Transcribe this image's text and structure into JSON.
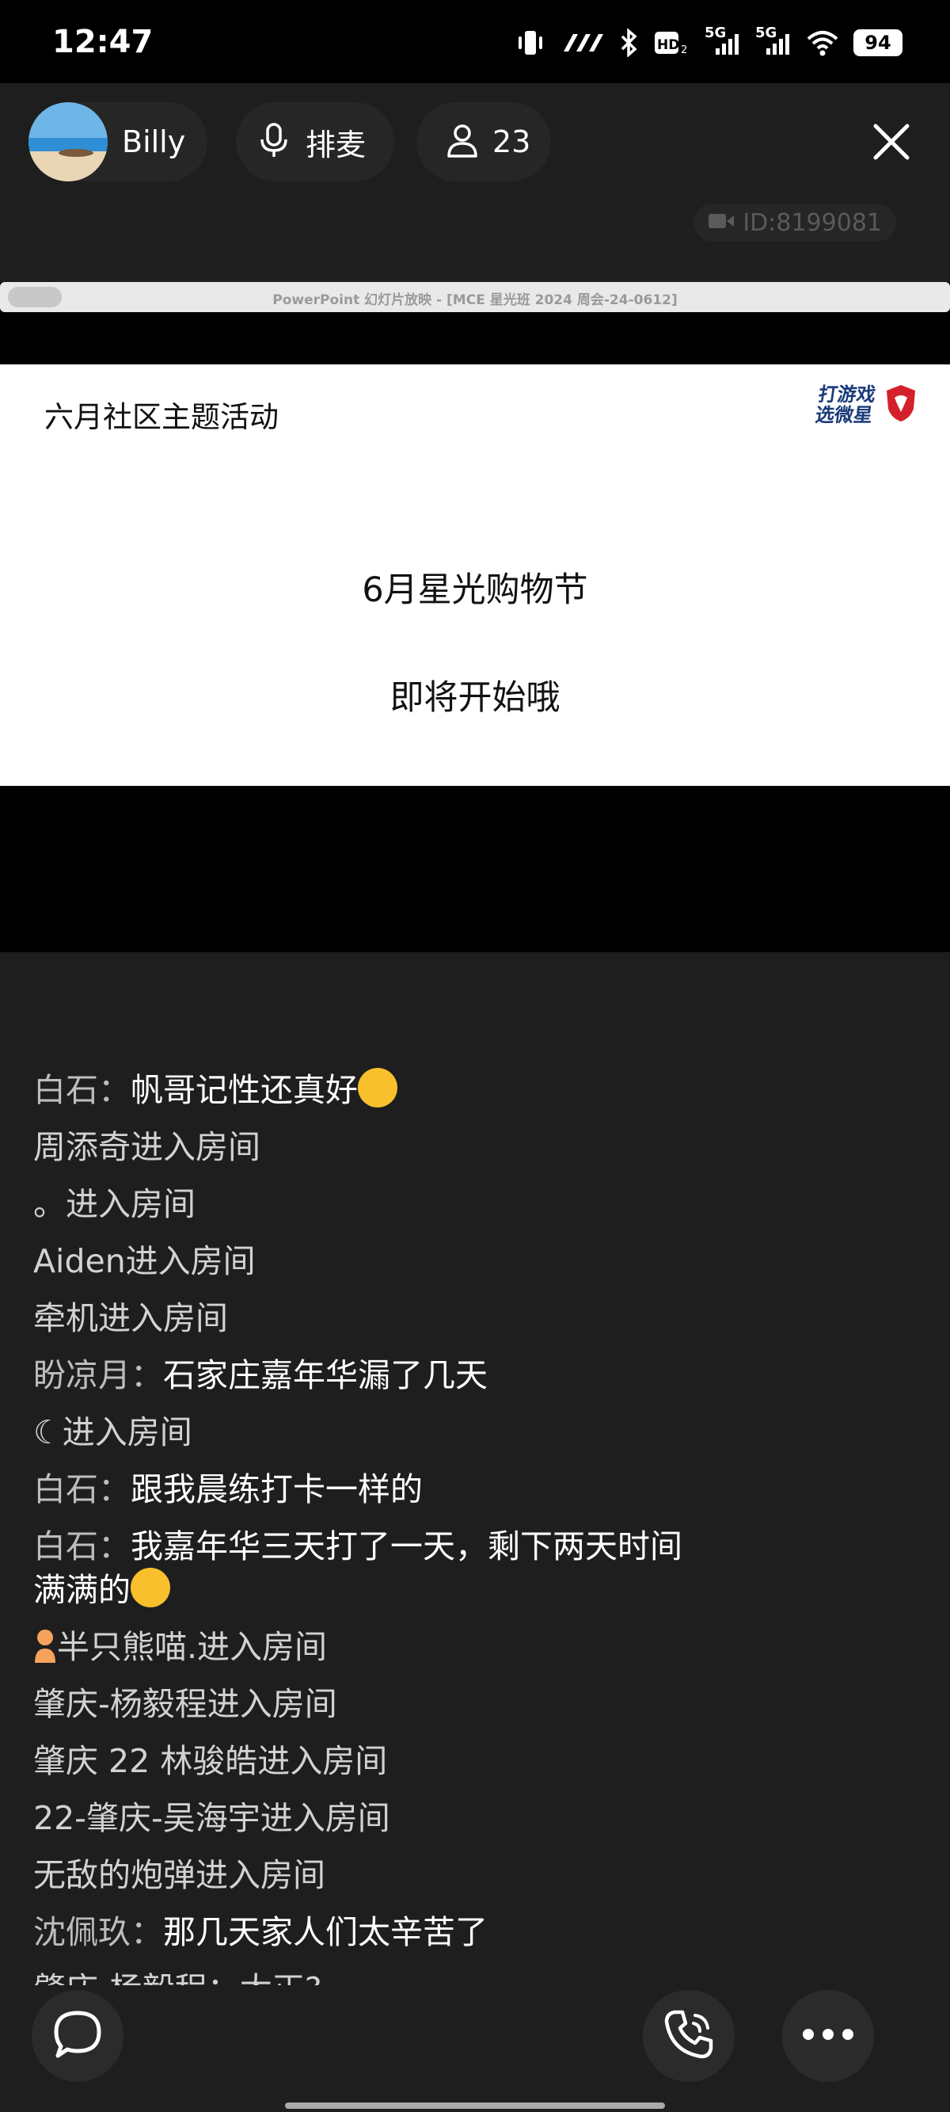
{
  "status_bar": {
    "time": "12:47",
    "network_1": "5G",
    "network_2": "5G",
    "battery": "94",
    "icons": [
      "vibrate-icon",
      "data-speed-icon",
      "bluetooth-icon",
      "hd-icon",
      "signal-icon",
      "wifi-icon",
      "battery-icon"
    ]
  },
  "header": {
    "host_name": "Billy",
    "mic_label": "排麦",
    "viewer_count": "23",
    "room_id": "ID:8199081"
  },
  "stream": {
    "ppt_title": "PowerPoint 幻灯片放映 - [MCE 星光班 2024 周会-24-0612]",
    "slide_title": "六月社区主题活动",
    "logo_text_line1": "打游戏",
    "logo_text_line2": "选微星",
    "slide_line1": "6月星光购物节",
    "slide_line2": "即将开始哦"
  },
  "chat": {
    "messages": [
      {
        "user": "白石：",
        "content": "帆哥记性还真好"
      },
      {
        "text": "周添奇进入房间"
      },
      {
        "text": "。进入房间"
      },
      {
        "text": "Aiden进入房间"
      },
      {
        "text": "牵机进入房间"
      },
      {
        "user": "盼凉月：",
        "content": "石家庄嘉年华漏了几天"
      },
      {
        "text": "☾进入房间"
      },
      {
        "user": "白石：",
        "content": "跟我晨练打卡一样的"
      },
      {
        "user": "白石：",
        "content": "我嘉年华三天打了一天，剩下两天时间满满的"
      },
      {
        "text": "半只熊喵.进入房间"
      },
      {
        "text": "肇庆-杨毅程进入房间"
      },
      {
        "text": "肇庆 22 林骏皓进入房间"
      },
      {
        "text": "22-肇庆-吴海宇进入房间"
      },
      {
        "text": "无敌的炮弹进入房间"
      },
      {
        "user": "沈佩玖：",
        "content": "那几天家人们太辛苦了"
      },
      {
        "text": "肇庆-杨毅程：太正?"
      }
    ]
  },
  "colors": {
    "background": "#1e1e1e",
    "pill": "#262626",
    "status_bar": "#000000",
    "slide": "#ffffff"
  }
}
